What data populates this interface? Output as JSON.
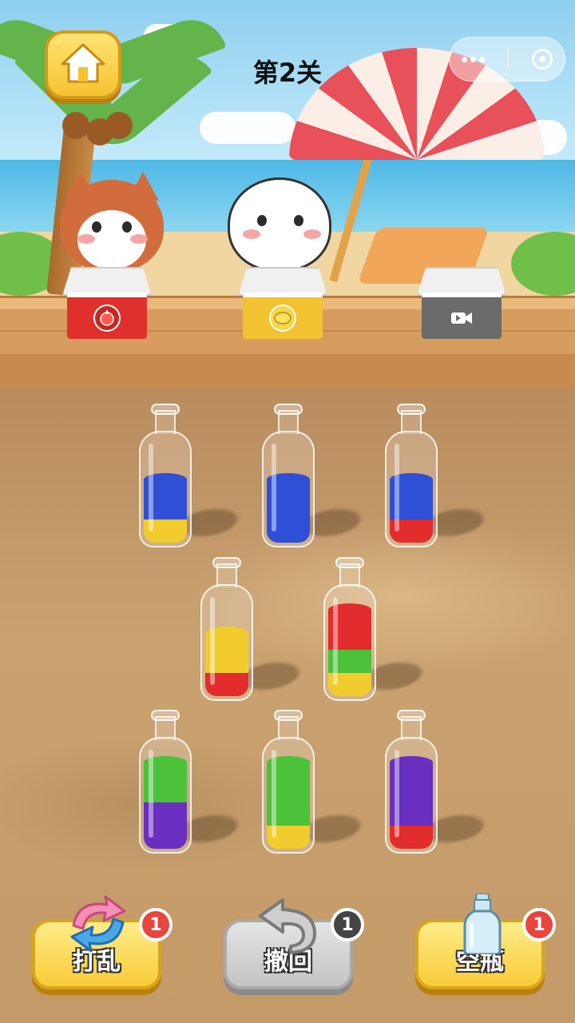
{
  "header": {
    "level_title": "第2关"
  },
  "boxes": [
    {
      "name": "apple",
      "color": "#e0302c",
      "icon": "apple-icon"
    },
    {
      "name": "lemon",
      "color": "#f2c230",
      "icon": "lemon-icon"
    },
    {
      "name": "video",
      "color": "#6b6b6b",
      "icon": "video-icon"
    }
  ],
  "liquid_colors": {
    "blue": "#2f4fd6",
    "yellow": "#f2cc2c",
    "red": "#e32c2c",
    "green": "#4cc13a",
    "purple": "#6a2fc0"
  },
  "bottles": [
    {
      "layers": [
        "yellow",
        "blue",
        "blue"
      ]
    },
    {
      "layers": [
        "blue",
        "blue",
        "blue"
      ]
    },
    {
      "layers": [
        "red",
        "blue",
        "blue"
      ]
    },
    {
      "layers": [
        "red",
        "yellow",
        "yellow"
      ]
    },
    {
      "layers": [
        "yellow",
        "green",
        "red",
        "red"
      ]
    },
    {
      "layers": [
        "purple",
        "purple",
        "green",
        "green"
      ]
    },
    {
      "layers": [
        "yellow",
        "green",
        "green",
        "green"
      ]
    },
    {
      "layers": [
        "red",
        "purple",
        "purple",
        "purple"
      ]
    }
  ],
  "tools": {
    "shuffle": {
      "label": "打乱",
      "count": "1",
      "icon": "shuffle-arrows-icon"
    },
    "undo": {
      "label": "撤回",
      "count": "1",
      "icon": "undo-arrow-icon"
    },
    "empty_bottle": {
      "label": "空瓶",
      "count": "1",
      "icon": "empty-bottle-icon"
    }
  }
}
